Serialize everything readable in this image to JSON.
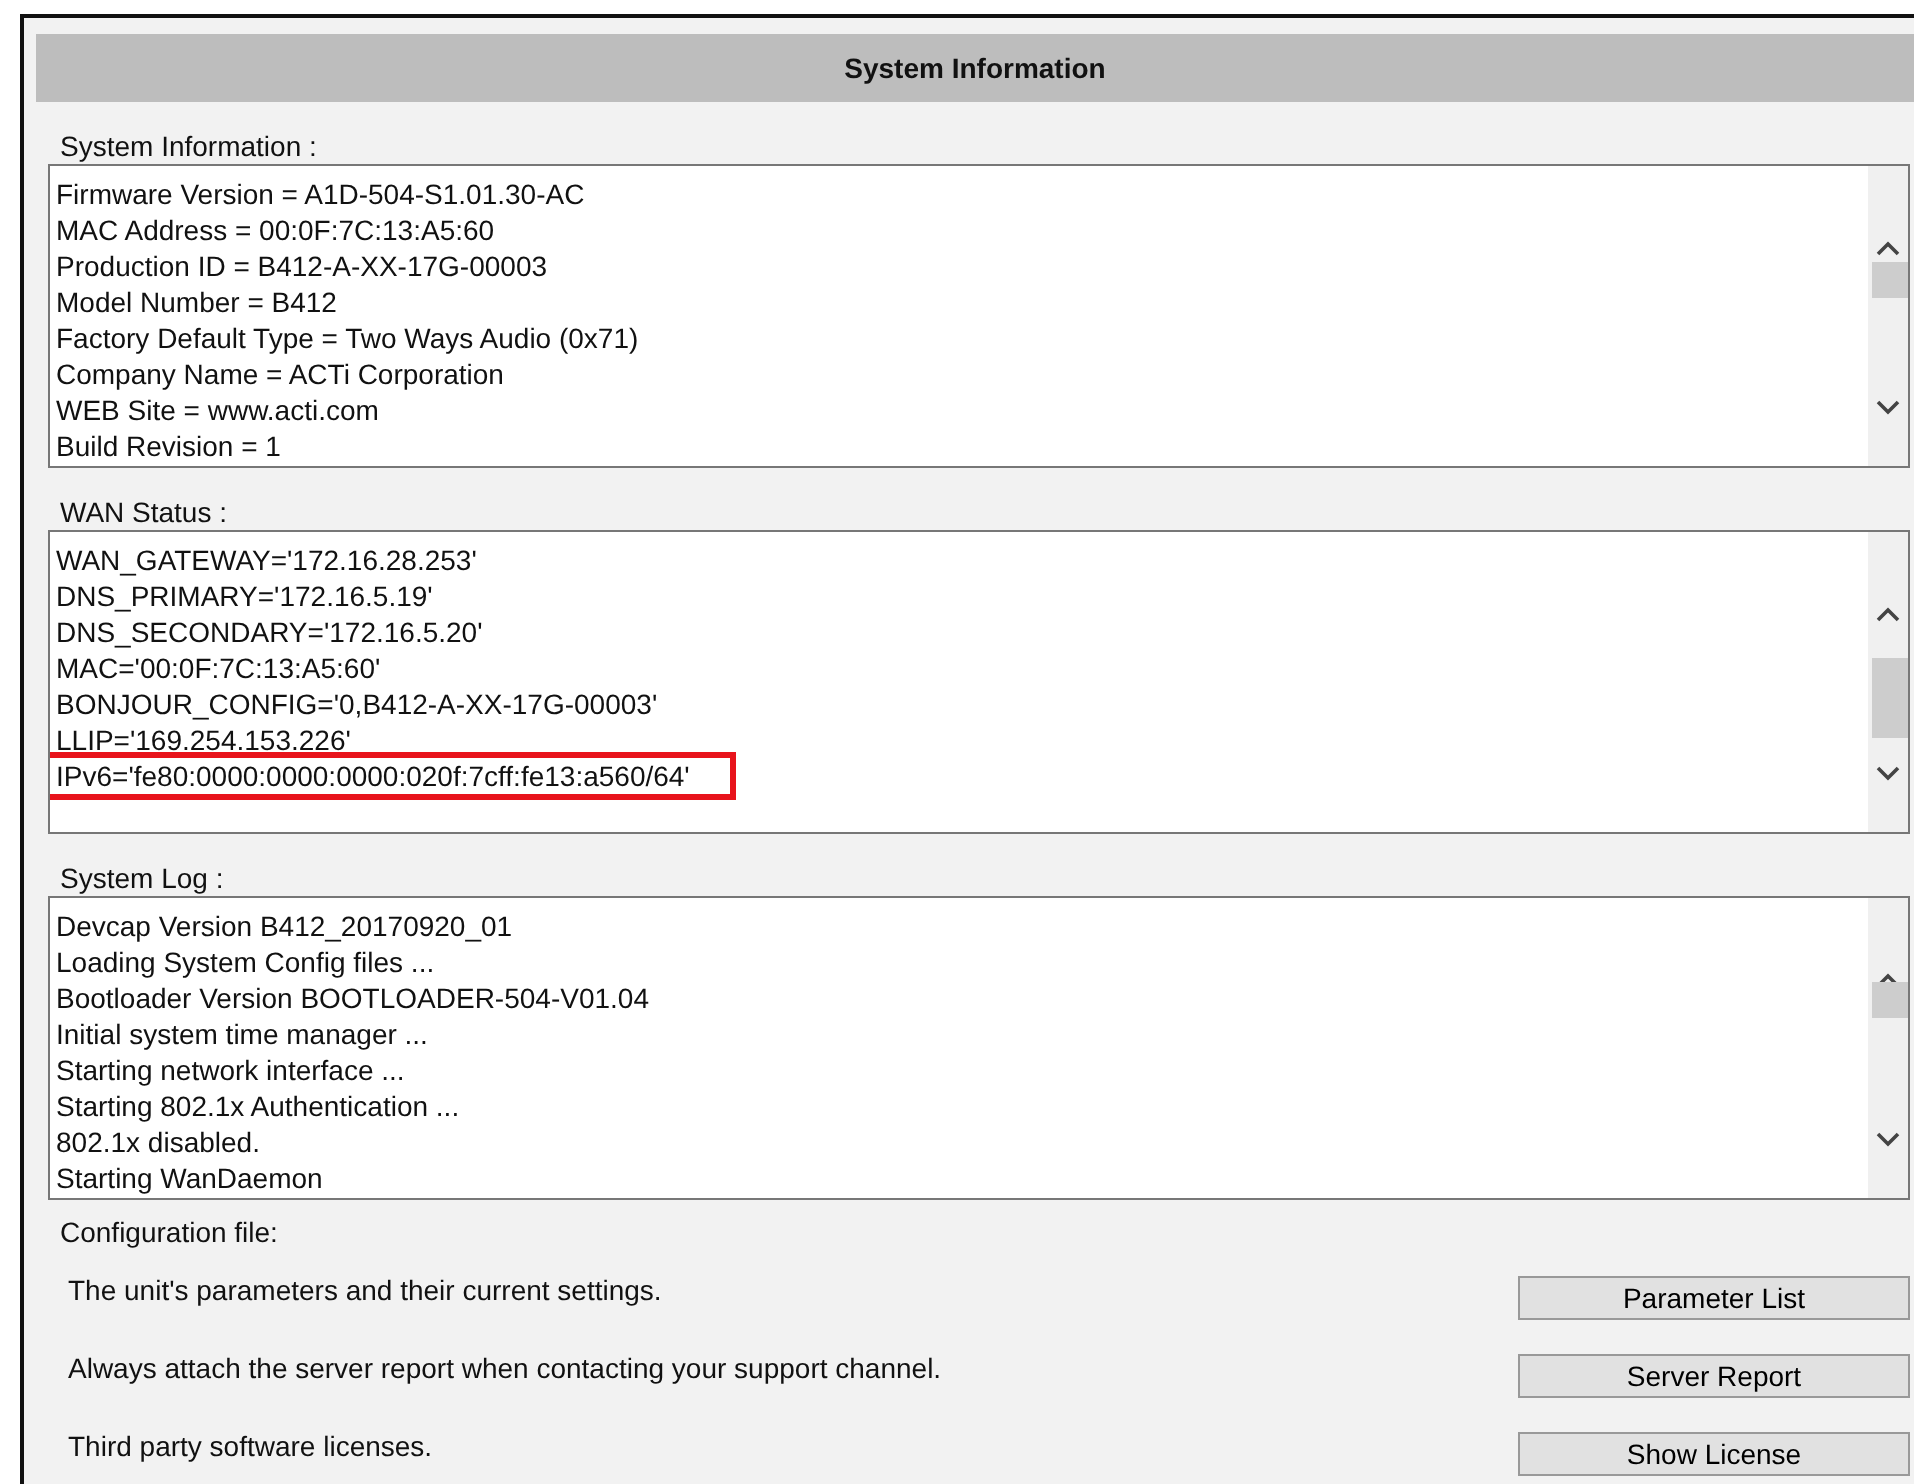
{
  "header": {
    "title": "System Information"
  },
  "sections": [
    {
      "label": "System Information :",
      "lines": [
        {
          "text": "Firmware Version = A1D-504-S1.01.30-AC",
          "highlighted": false
        },
        {
          "text": "MAC Address = 00:0F:7C:13:A5:60",
          "highlighted": false
        },
        {
          "text": "Production ID = B412-A-XX-17G-00003",
          "highlighted": false
        },
        {
          "text": "Model Number = B412",
          "highlighted": false
        },
        {
          "text": "Factory Default Type = Two Ways Audio (0x71)",
          "highlighted": false
        },
        {
          "text": "Company Name = ACTi Corporation",
          "highlighted": false
        },
        {
          "text": "WEB Site = www.acti.com",
          "highlighted": false
        },
        {
          "text": "Build Revision = 1",
          "highlighted": false
        }
      ]
    },
    {
      "label": "WAN Status :",
      "lines": [
        {
          "text": "WAN_GATEWAY='172.16.28.253'",
          "highlighted": false
        },
        {
          "text": "DNS_PRIMARY='172.16.5.19'",
          "highlighted": false
        },
        {
          "text": "DNS_SECONDARY='172.16.5.20'",
          "highlighted": false
        },
        {
          "text": "MAC='00:0F:7C:13:A5:60'",
          "highlighted": false
        },
        {
          "text": "BONJOUR_CONFIG='0,B412-A-XX-17G-00003'",
          "highlighted": false
        },
        {
          "text": "LLIP='169.254.153.226'",
          "highlighted": false
        },
        {
          "text": "IPv6='fe80:0000:0000:0000:020f:7cff:fe13:a560/64'",
          "highlighted": true
        }
      ]
    },
    {
      "label": "System Log :",
      "lines": [
        {
          "text": "Devcap Version B412_20170920_01",
          "highlighted": false
        },
        {
          "text": "Loading System Config files ...",
          "highlighted": false
        },
        {
          "text": "Bootloader Version BOOTLOADER-504-V01.04",
          "highlighted": false
        },
        {
          "text": "Initial system time manager ...",
          "highlighted": false
        },
        {
          "text": "Starting network interface ...",
          "highlighted": false
        },
        {
          "text": "Starting 802.1x Authentication ...",
          "highlighted": false
        },
        {
          "text": "802.1x disabled.",
          "highlighted": false
        },
        {
          "text": "Starting WanDaemon",
          "highlighted": false
        }
      ]
    }
  ],
  "config": {
    "label": "Configuration file:",
    "rows": [
      {
        "description": "The unit's parameters and their current settings.",
        "button": "Parameter List"
      },
      {
        "description": "Always attach the server report when contacting your support channel.",
        "button": "Server Report"
      },
      {
        "description": "Third party software licenses.",
        "button": "Show License"
      }
    ]
  }
}
